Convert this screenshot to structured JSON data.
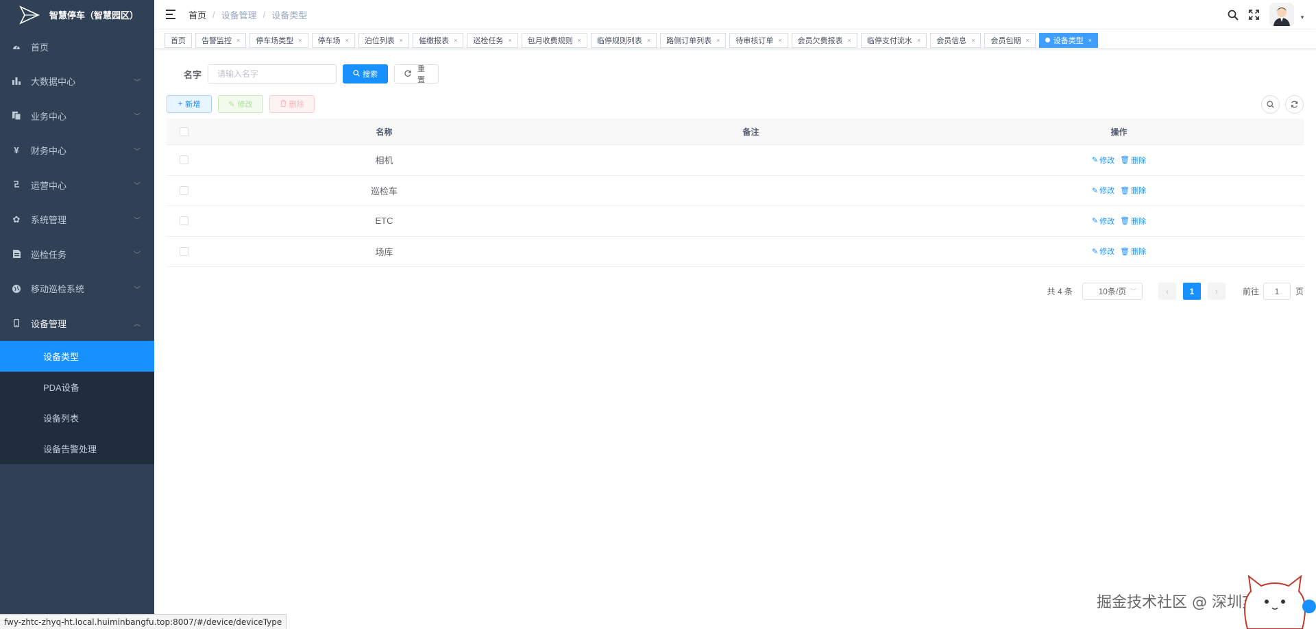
{
  "app": {
    "title": "智慧停车（智慧园区）"
  },
  "sidebar": {
    "items": [
      {
        "label": "首页",
        "icon": "dashboard-icon",
        "expandable": false
      },
      {
        "label": "大数据中心",
        "icon": "bar-chart-icon",
        "expandable": true
      },
      {
        "label": "业务中心",
        "icon": "documents-icon",
        "expandable": true
      },
      {
        "label": "财务中心",
        "icon": "yen-icon",
        "expandable": true
      },
      {
        "label": "运营中心",
        "icon": "operation-icon",
        "expandable": true
      },
      {
        "label": "系统管理",
        "icon": "gear-icon",
        "expandable": true
      },
      {
        "label": "巡检任务",
        "icon": "file-icon",
        "expandable": true
      },
      {
        "label": "移动巡检系统",
        "icon": "globe-icon",
        "expandable": true
      },
      {
        "label": "设备管理",
        "icon": "phone-icon",
        "expandable": true,
        "expanded": true
      }
    ],
    "sub_items": [
      {
        "label": "设备类型",
        "active": true
      },
      {
        "label": "PDA设备",
        "active": false
      },
      {
        "label": "设备列表",
        "active": false
      },
      {
        "label": "设备告警处理",
        "active": false
      }
    ]
  },
  "header": {
    "breadcrumb": [
      "首页",
      "设备管理",
      "设备类型"
    ]
  },
  "tags": [
    {
      "label": "首页",
      "closable": false,
      "active": false
    },
    {
      "label": "告警监控",
      "closable": true,
      "active": false
    },
    {
      "label": "停车场类型",
      "closable": true,
      "active": false
    },
    {
      "label": "停车场",
      "closable": true,
      "active": false
    },
    {
      "label": "泊位列表",
      "closable": true,
      "active": false
    },
    {
      "label": "催缴报表",
      "closable": true,
      "active": false
    },
    {
      "label": "巡检任务",
      "closable": true,
      "active": false
    },
    {
      "label": "包月收费规则",
      "closable": true,
      "active": false
    },
    {
      "label": "临停规则列表",
      "closable": true,
      "active": false
    },
    {
      "label": "路侧订单列表",
      "closable": true,
      "active": false
    },
    {
      "label": "待审核订单",
      "closable": true,
      "active": false
    },
    {
      "label": "会员欠费报表",
      "closable": true,
      "active": false
    },
    {
      "label": "临停支付流水",
      "closable": true,
      "active": false
    },
    {
      "label": "会员信息",
      "closable": true,
      "active": false
    },
    {
      "label": "会员包期",
      "closable": true,
      "active": false
    },
    {
      "label": "设备类型",
      "closable": true,
      "active": true
    }
  ],
  "search": {
    "label": "名字",
    "placeholder": "请输入名字",
    "value": "",
    "search_label": "搜索",
    "reset_label": "重置"
  },
  "toolbar": {
    "add_label": "新增",
    "edit_label": "修改",
    "delete_label": "删除"
  },
  "table": {
    "columns": [
      "名称",
      "备注",
      "操作"
    ],
    "rows": [
      {
        "name": "相机",
        "remark": ""
      },
      {
        "name": "巡检车",
        "remark": ""
      },
      {
        "name": "ETC",
        "remark": ""
      },
      {
        "name": "场库",
        "remark": ""
      }
    ],
    "edit_label": "修改",
    "delete_label": "删除"
  },
  "pagination": {
    "total_text": "共 4 条",
    "page_size": "10条/页",
    "current_page": "1",
    "goto_label": "前往",
    "goto_value": "1",
    "page_unit": "页"
  },
  "statusbar": {
    "url": "fwy-zhtc-zhyq-ht.local.huiminbangfu.top:8007/#/device/deviceType"
  },
  "watermark": "掘金技术社区 @ 深圳亥时科技"
}
